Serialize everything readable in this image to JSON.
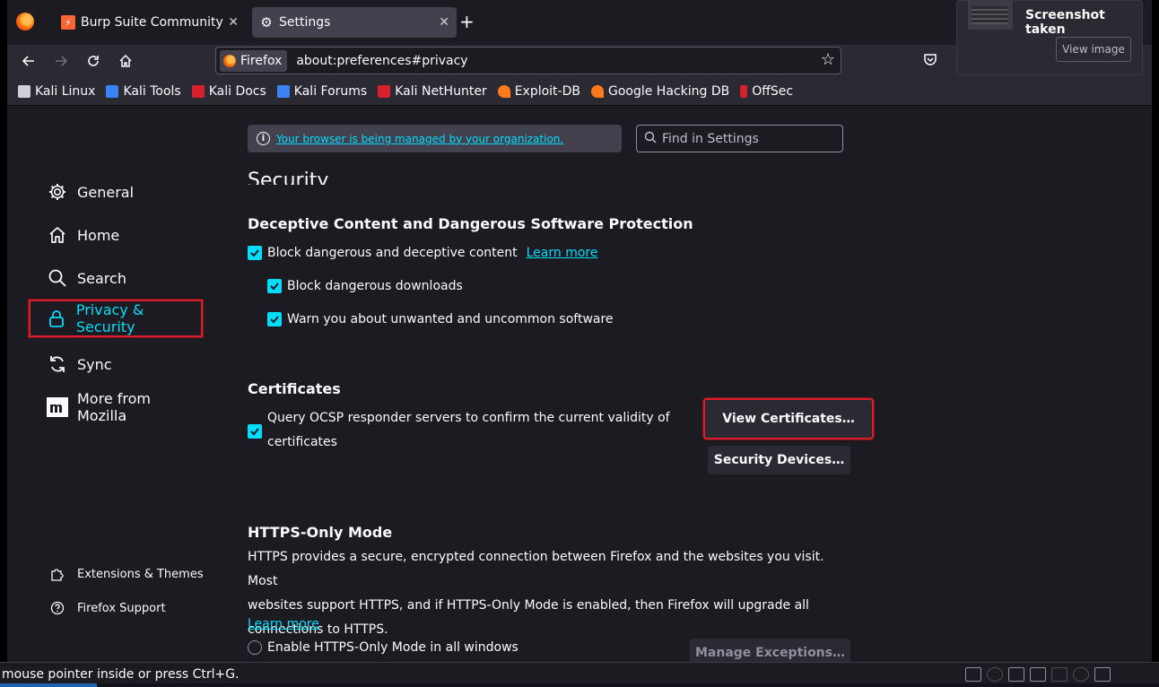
{
  "tabs": [
    {
      "title": "Burp Suite Community Ed",
      "favicon": "burp-icon"
    },
    {
      "title": "Settings",
      "favicon": "gear-icon",
      "active": true
    }
  ],
  "nav": {
    "identity_label": "Firefox",
    "url": "about:preferences#privacy"
  },
  "bookmarks": [
    {
      "label": "Kali Linux",
      "icon": "kali-dragon-icon",
      "color": "#cfcfd6"
    },
    {
      "label": "Kali Tools",
      "icon": "kali-tools-icon",
      "color": "#3b82f6"
    },
    {
      "label": "Kali Docs",
      "icon": "kali-docs-icon",
      "color": "#d7202b"
    },
    {
      "label": "Kali Forums",
      "icon": "kali-forums-icon",
      "color": "#3b82f6"
    },
    {
      "label": "Kali NetHunter",
      "icon": "nethunter-icon",
      "color": "#d7202b"
    },
    {
      "label": "Exploit-DB",
      "icon": "exploitdb-icon",
      "color": "#ff7a1a"
    },
    {
      "label": "Google Hacking DB",
      "icon": "ghdb-icon",
      "color": "#ff7a1a"
    },
    {
      "label": "OffSec",
      "icon": "offsec-icon",
      "color": "#d7202b"
    }
  ],
  "notification": {
    "title": "Screenshot taken",
    "button": "View image"
  },
  "policy": {
    "link_text": "Your browser is being managed by your organization."
  },
  "search": {
    "placeholder": "Find in Settings"
  },
  "sidebar": {
    "categories": [
      {
        "label": "General",
        "icon": "gear-icon"
      },
      {
        "label": "Home",
        "icon": "home-icon"
      },
      {
        "label": "Search",
        "icon": "search-icon"
      },
      {
        "label": "Privacy & Security",
        "icon": "lock-icon",
        "selected": true
      },
      {
        "label": "Sync",
        "icon": "sync-icon"
      },
      {
        "label": "More from Mozilla",
        "icon": "mozilla-icon"
      }
    ],
    "footer": [
      {
        "label": "Extensions & Themes",
        "icon": "puzzle-icon"
      },
      {
        "label": "Firefox Support",
        "icon": "help-icon"
      }
    ]
  },
  "main": {
    "section_title": "Security",
    "deceptive": {
      "heading": "Deceptive Content and Dangerous Software Protection",
      "block_label": "Block dangerous and deceptive content",
      "learn_more": "Learn more",
      "downloads_label": "Block dangerous downloads",
      "warn_label": "Warn you about unwanted and uncommon software"
    },
    "certificates": {
      "heading": "Certificates",
      "ocsp_label_line1": "Query OCSP responder servers to confirm the current validity of",
      "ocsp_label_line2": "certificates",
      "view_button": "View Certificates…",
      "devices_button": "Security Devices…"
    },
    "https": {
      "heading": "HTTPS-Only Mode",
      "line1": "HTTPS provides a secure, encrypted connection between Firefox and the websites you visit. Most",
      "line2": "websites support HTTPS, and if HTTPS-Only Mode is enabled, then Firefox will upgrade all",
      "line3": "connections to HTTPS.",
      "learn_more": "Learn more",
      "radio_label": "Enable HTTPS-Only Mode in all windows",
      "manage_button": "Manage Exceptions…"
    }
  },
  "status": {
    "text": "mouse pointer inside or press Ctrl+G."
  },
  "colors": {
    "accent": "#00ddff",
    "highlight_border": "#d7202b"
  }
}
